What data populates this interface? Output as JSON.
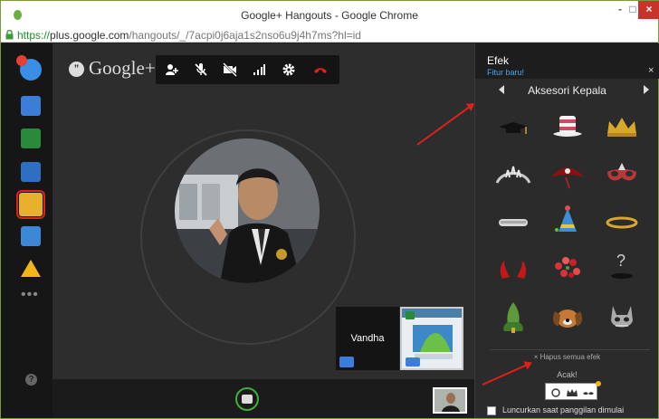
{
  "window": {
    "title": "Google+ Hangouts - Google Chrome",
    "minimize": "-",
    "maximize": "□",
    "close": "×"
  },
  "address_bar": {
    "scheme": "https://",
    "host": "plus.google.com",
    "path": "/hangouts/_/7acpi0j6aja1s2nso6u9j4h7ms?hl=id"
  },
  "left_apps": [
    {
      "name": "hangouts-app",
      "icon": "hangouts-icon"
    },
    {
      "name": "chat-app",
      "icon": "chat-icon"
    },
    {
      "name": "screenshare-app",
      "icon": "screenshare-icon"
    },
    {
      "name": "photo-app",
      "icon": "camera-icon"
    },
    {
      "name": "effects-app",
      "icon": "effects-icon",
      "selected": true
    },
    {
      "name": "remote-desktop-app",
      "icon": "remote-desktop-icon"
    },
    {
      "name": "drive-app",
      "icon": "drive-icon"
    },
    {
      "name": "more-apps",
      "icon": "more-icon"
    }
  ],
  "help_label": "?",
  "logo": {
    "mark": "”",
    "text": "Google+"
  },
  "toolbar": {
    "icons": [
      "invite-people-icon",
      "mute-mic-icon",
      "turn-off-camera-icon",
      "bandwidth-icon",
      "settings-icon",
      "hang-up-icon"
    ],
    "hangup_color": "#e0201c"
  },
  "participants": [
    {
      "name": "Vandha"
    }
  ],
  "effects_panel": {
    "title": "Efek",
    "subtitle": "Fitur baru!",
    "close": "×",
    "category": "Aksesori Kepala",
    "accessories": [
      "mortarboard-hat-icon",
      "striped-top-hat-icon",
      "crown-icon",
      "tiara-icon",
      "pirate-hat-icon",
      "masquerade-mask-icon",
      "headband-icon",
      "party-hat-icon",
      "halo-icon",
      "devil-horns-icon",
      "flower-crown-icon",
      "random-question-icon",
      "green-feather-hat-icon",
      "dog-ears-icon",
      "cat-mask-icon"
    ],
    "clear_all": "× Hapus semua efek",
    "random_label": "Acak!",
    "launch_label": "Luncurkan saat panggilan dimulai"
  },
  "colors": {
    "accent_red": "#e0201c",
    "link_blue": "#4aa7f0",
    "shutter_green": "#3fae3f"
  }
}
